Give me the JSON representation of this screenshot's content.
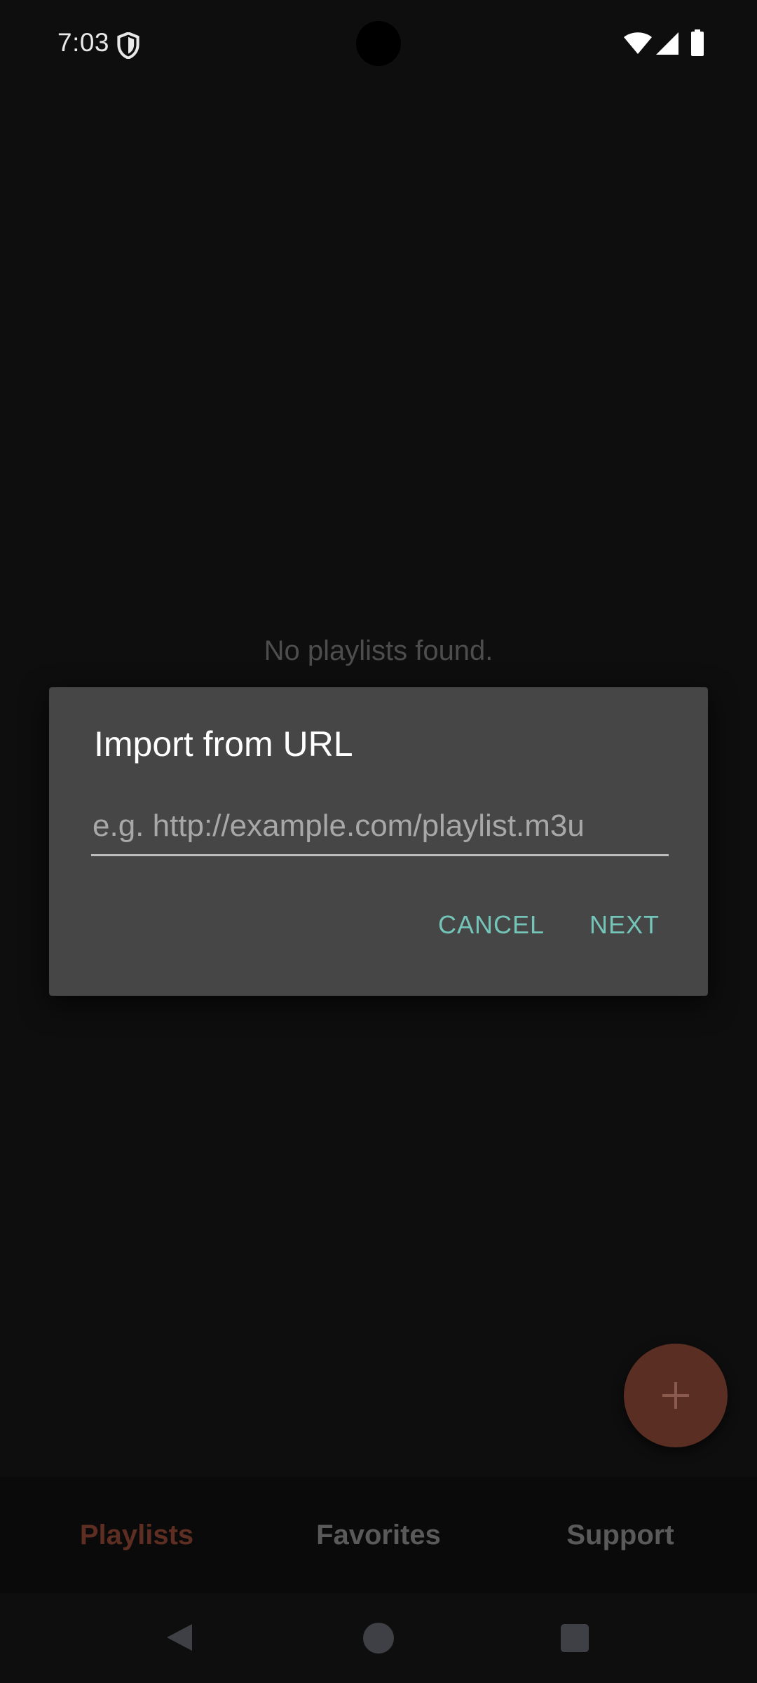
{
  "status_bar": {
    "time": "7:03",
    "icons": [
      "shield-icon",
      "wifi-icon",
      "signal-icon",
      "battery-icon"
    ]
  },
  "main": {
    "empty_message": "No playlists found."
  },
  "dialog": {
    "title": "Import from URL",
    "url_input": {
      "value": "",
      "placeholder": "e.g. http://example.com/playlist.m3u"
    },
    "cancel_label": "CANCEL",
    "next_label": "NEXT"
  },
  "fab": {
    "icon": "plus-icon"
  },
  "bottom_nav": {
    "tabs": [
      {
        "label": "Playlists",
        "selected": true
      },
      {
        "label": "Favorites",
        "selected": false
      },
      {
        "label": "Support",
        "selected": false
      }
    ]
  },
  "system_nav": {
    "icons": [
      "back-icon",
      "home-icon",
      "recents-icon"
    ]
  },
  "colors": {
    "background": "#0e0e0e",
    "dialog_background": "#464646",
    "accent_teal": "#74c4b8",
    "fab_background": "#5a2e22",
    "selected_tab": "#5e2e23",
    "unselected_tab": "#5a5a5a"
  }
}
